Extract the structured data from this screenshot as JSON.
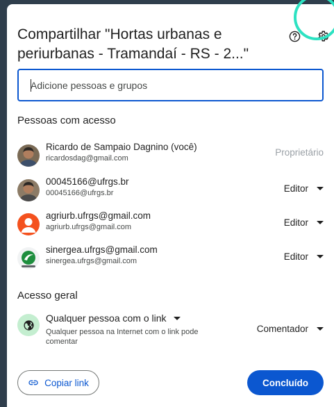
{
  "dialog": {
    "title": "Compartilhar \"Hortas urbanas e periurbanas - Tramandaí - RS - 2...\""
  },
  "input": {
    "placeholder": "Adicione pessoas e grupos",
    "value": ""
  },
  "people_section": {
    "label": "Pessoas com acesso"
  },
  "people": [
    {
      "name": "Ricardo de Sampaio Dagnino (você)",
      "email": "ricardosdag@gmail.com",
      "role": "Proprietário",
      "avatar": "photo"
    },
    {
      "name": "00045166@ufrgs.br",
      "email": "00045166@ufrgs.br",
      "role": "Editor",
      "avatar": "photo"
    },
    {
      "name": "agriurb.ufrgs@gmail.com",
      "email": "agriurb.ufrgs@gmail.com",
      "role": "Editor",
      "avatar": "person-icon"
    },
    {
      "name": "sinergea.ufrgs@gmail.com",
      "email": "sinergea.ufrgs@gmail.com",
      "role": "Editor",
      "avatar": "logo"
    }
  ],
  "general_section": {
    "label": "Acesso geral"
  },
  "general_access": {
    "selection": "Qualquer pessoa com o link",
    "description": "Qualquer pessoa na Internet com o link pode comentar",
    "role": "Comentador",
    "icon": "globe-icon"
  },
  "buttons": {
    "copy_link": "Copiar link",
    "done": "Concluído"
  },
  "colors": {
    "accent": "#0b57d0",
    "highlight_ring": "#2de2c2",
    "backdrop": "#2f3e4c"
  }
}
